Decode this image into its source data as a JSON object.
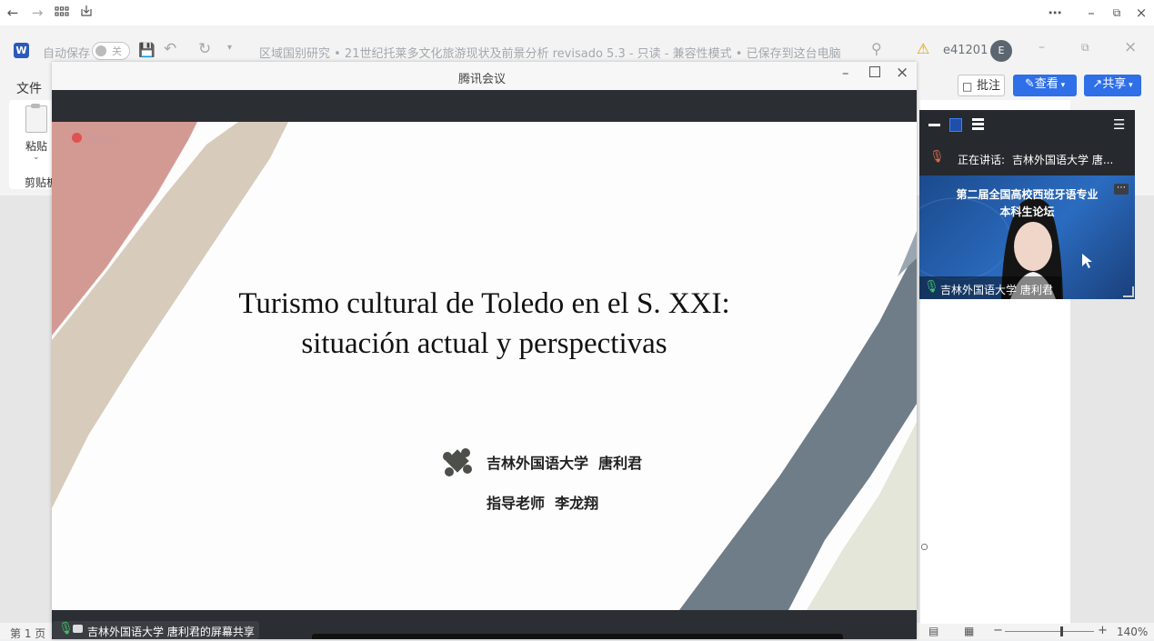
{
  "word": {
    "autosave_label": "自动保存",
    "autosave_state": "关",
    "doc_title": "区域国别研究 • 21世纪托莱多文化旅游现状及前景分析 revisado 5.3  -  只读  -  兼容性模式 • 已保存到这台电脑",
    "user_name": "e41201",
    "user_initial": "E",
    "file_tab": "文件",
    "paste_label": "粘贴",
    "clipboard_label": "剪贴板",
    "comment_button": "批注",
    "view_button": "查看",
    "share_button": "共享",
    "page_indicator": "第 1 页",
    "zoom_level": "140%",
    "zoom_fraction": 0.62
  },
  "meeting": {
    "window_title": "腾讯会议",
    "recording_label": "录制中",
    "share_status": "吉林外国语大学 唐利君的屏幕共享",
    "speaking_label": "正在讲话:",
    "speaking_name": "吉林外国语大学 唐...",
    "video_caption_line1": "第二届全国高校西班牙语专业",
    "video_caption_line2": "本科生论坛",
    "participant_name": "吉林外国语大学 唐利君"
  },
  "slide": {
    "title_line1": "Turismo cultural de Toledo en el S. XXI:",
    "title_line2": "situación actual y perspectivas",
    "author": "吉林外国语大学  唐利君",
    "advisor": "指导老师  李龙翔"
  }
}
